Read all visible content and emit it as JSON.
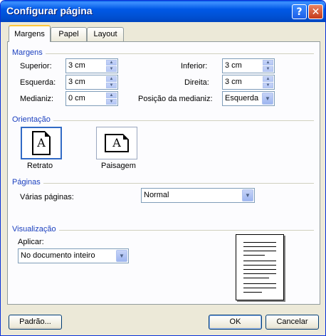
{
  "window": {
    "title": "Configurar página"
  },
  "tabs": [
    {
      "label": "Margens",
      "active": true
    },
    {
      "label": "Papel",
      "active": false
    },
    {
      "label": "Layout",
      "active": false
    }
  ],
  "margins": {
    "section_label": "Margens",
    "superior": {
      "label": "Superior:",
      "value": "3 cm"
    },
    "inferior": {
      "label": "Inferior:",
      "value": "3 cm"
    },
    "esquerda": {
      "label": "Esquerda:",
      "value": "3 cm"
    },
    "direita": {
      "label": "Direita:",
      "value": "3 cm"
    },
    "medianiz": {
      "label": "Medianiz:",
      "value": "0 cm"
    },
    "posicao_medianiz": {
      "label": "Posição da medianiz:",
      "value": "Esquerda"
    }
  },
  "orientation": {
    "section_label": "Orientação",
    "portrait": {
      "label": "Retrato",
      "glyph": "A",
      "selected": true
    },
    "landscape": {
      "label": "Paisagem",
      "glyph": "A",
      "selected": false
    }
  },
  "pages": {
    "section_label": "Páginas",
    "multiple_pages_label": "Várias páginas:",
    "multiple_pages_value": "Normal"
  },
  "preview": {
    "section_label": "Visualização",
    "apply_label": "Aplicar:",
    "apply_value": "No documento inteiro"
  },
  "buttons": {
    "default": "Padrão...",
    "ok": "OK",
    "cancel": "Cancelar"
  },
  "icons": {
    "help": "help-icon",
    "close": "close-icon",
    "spin": "spin-arrows-icon",
    "dropdown": "chevron-down-icon"
  },
  "colors": {
    "titlebar": "#0058e6",
    "section_label": "#1a3fbe",
    "dialog_bg": "#ece9d8",
    "active_tab_accent": "#ffc83c"
  }
}
